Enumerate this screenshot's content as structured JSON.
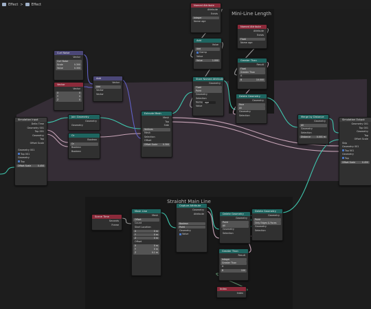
{
  "header": {
    "crumb1": "Effect",
    "sep": ">",
    "crumb2": "Effect"
  },
  "frames": {
    "mini": "Mini-Line Length",
    "straight": "Straight Main Line"
  },
  "nodes": {
    "named_top": {
      "title": "Named Attribute",
      "rows": [
        "Attribute",
        "Exists",
        "Integer",
        "Name",
        "age"
      ]
    },
    "curl": {
      "title": "Curl Noise",
      "rows": [
        "Vector",
        "Curl Noise",
        "Scale",
        "0.300",
        "Value",
        "0.300"
      ]
    },
    "vector": {
      "title": "Vector",
      "rows": [
        "Vector",
        "X",
        "0",
        "Y",
        "0",
        "Z",
        "0"
      ]
    },
    "add": {
      "title": "Add",
      "rows": [
        "Vector",
        "Add",
        "Vector",
        "Vector"
      ]
    },
    "add2": {
      "title": "Add",
      "rows": [
        "Value",
        "Add",
        "Clamp",
        "Value",
        "Value",
        "1.000"
      ]
    },
    "sim_in": {
      "title": "Simulation Input",
      "rows": [
        "Delta Time",
        "Geometry 001",
        "Top 001",
        "Geometry",
        "Top",
        "Offset Scale",
        "Geometry 001",
        "Top 001",
        "Geometry",
        "Top",
        "Offset Scale",
        "0.450"
      ]
    },
    "set_pos": {
      "title": "Join Geometry",
      "rows": [
        "Geometry",
        "Geometry"
      ]
    },
    "or": {
      "title": "Or",
      "rows": [
        "Boolean",
        "Or",
        "Boolean",
        "Boolean"
      ]
    },
    "extrude": {
      "title": "Extrude Mesh",
      "rows": [
        "Mesh",
        "Top",
        "Side",
        "Vertices",
        "Mesh",
        "Selection",
        "Offset",
        "Offset Scale",
        "0.300"
      ]
    },
    "store": {
      "title": "Store Named Attribute",
      "rows": [
        "Geometry",
        "Float",
        "Point",
        "Geometry",
        "Selection",
        "Name",
        "age",
        "Value"
      ]
    },
    "named_mini": {
      "title": "Named Attribute",
      "rows": [
        "Attribute",
        "Exists",
        "Float",
        "Name",
        "age"
      ]
    },
    "greater": {
      "title": "Greater Than",
      "rows": [
        "Result",
        "Float",
        "Greater Than",
        "A",
        "B",
        "10.000"
      ]
    },
    "delete_geo": {
      "title": "Delete Geometry",
      "rows": [
        "Geometry",
        "Face",
        "All",
        "Geometry",
        "Selection"
      ]
    },
    "merge": {
      "title": "Merge by Distance",
      "rows": [
        "Geometry",
        "All",
        "Geometry",
        "Selection",
        "Distance",
        "0.001 m"
      ]
    },
    "sim_out": {
      "title": "Simulation Output",
      "rows": [
        "Geometry 001",
        "Top 001",
        "Geometry",
        "Top",
        "Offset Scale",
        "Skip",
        "Geometry 001",
        "Top 001",
        "Geometry",
        "Top",
        "Offset Scale",
        "0.450"
      ]
    },
    "scene_time": {
      "title": "Scene Time",
      "rows": [
        "Seconds",
        "Frame"
      ]
    },
    "mesh_line": {
      "title": "Mesh Line",
      "rows": [
        "Mesh",
        "Offset",
        "Count",
        "Start Location",
        "X",
        "0 m",
        "Y",
        "0 m",
        "Z",
        "0 m",
        "Offset",
        "X",
        "0 m",
        "Y",
        "0 m",
        "Z",
        "0.1 m"
      ]
    },
    "capture": {
      "title": "Capture Attribute",
      "rows": [
        "Geometry",
        "Attribute",
        "Boolean",
        "Point",
        "Geometry",
        "Value"
      ]
    },
    "delete2": {
      "title": "Delete Geometry",
      "rows": [
        "Geometry",
        "Point",
        "All",
        "Geometry",
        "Selection"
      ]
    },
    "delete3": {
      "title": "Delete Geometry",
      "rows": [
        "Geometry",
        "Point",
        "Only Edges & Faces",
        "Geometry",
        "Selection"
      ]
    },
    "greater2": {
      "title": "Greater Than",
      "rows": [
        "Result",
        "Integer",
        "Greater Than",
        "A",
        "B",
        "100"
      ]
    },
    "index": {
      "title": "Index",
      "rows": [
        "Index"
      ]
    }
  }
}
